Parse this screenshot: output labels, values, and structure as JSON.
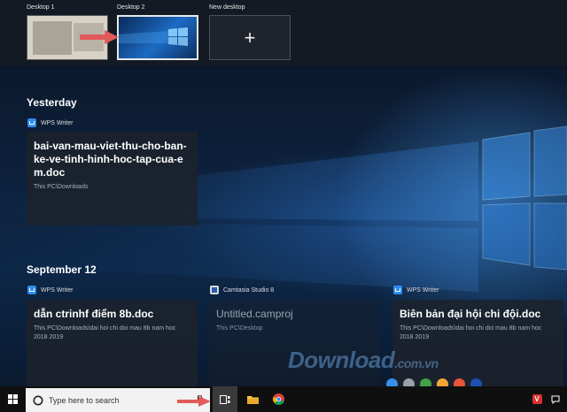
{
  "desktops": [
    {
      "label": "Desktop 1",
      "active": false
    },
    {
      "label": "Desktop 2",
      "active": true
    },
    {
      "label": "New desktop",
      "plus": "+"
    }
  ],
  "sections": [
    {
      "title": "Yesterday",
      "items": [
        {
          "app": "WPS Writer",
          "title": "bai-van-mau-viet-thu-cho-ban-ke-ve-tinh-hinh-hoc-tap-cua-em.doc",
          "path": "This PC\\Downloads"
        }
      ]
    },
    {
      "title": "September 12",
      "items": [
        {
          "app": "WPS Writer",
          "title": "dẫn ctrinhf điểm 8b.doc",
          "path": "This PC\\Downloads\\dai hoi chi doi mau 8b nam hoc 2018 2019"
        },
        {
          "app": "Camtasia Studio 8",
          "title": "Untitled.camproj",
          "path": "This PC\\Desktop"
        },
        {
          "app": "WPS Writer",
          "title": "Biên bản đại hội chi đội.doc",
          "path": "This PC\\Downloads\\dai hoi chi doi mau 8b nam hoc 2018 2019"
        }
      ]
    }
  ],
  "watermark": {
    "main": "Download",
    "suffix": ".com.vn"
  },
  "watermark_dot_colors": [
    "#3a8ee6",
    "#9aa0a6",
    "#43a047",
    "#f2a63a",
    "#e8553a",
    "#1e4fb0"
  ],
  "taskbar": {
    "search_placeholder": "Type here to search",
    "tray_icon_letter": "V"
  },
  "colors": {
    "accent": "#2f8cf0",
    "hint_arrow": "#e05a5a"
  }
}
